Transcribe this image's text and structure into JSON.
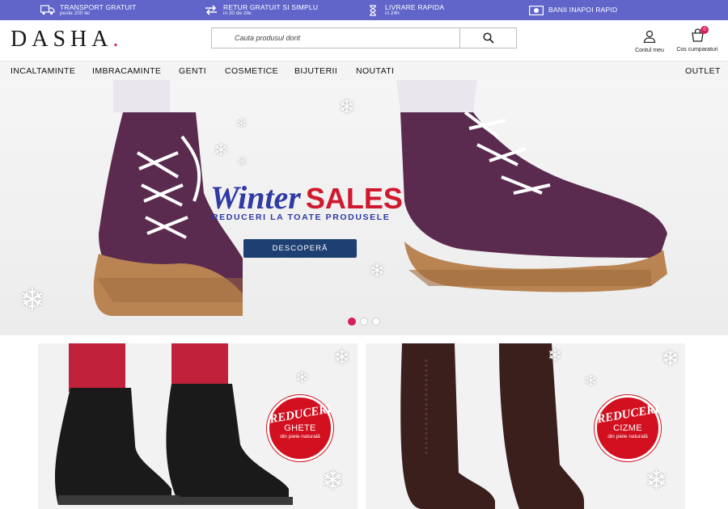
{
  "topbar": {
    "items": [
      {
        "icon": "truck-icon",
        "title": "TRANSPORT GRATUIT",
        "sub": "peste 200 lei"
      },
      {
        "icon": "exchange-icon",
        "title": "RETUR GRATUIT SI SIMPLU",
        "sub": "in 30 de zile"
      },
      {
        "icon": "hourglass-icon",
        "title": "LIVRARE RAPIDA",
        "sub": "in 24h"
      },
      {
        "icon": "money-icon",
        "title": "BANII INAPOI RAPID",
        "sub": ""
      }
    ]
  },
  "header": {
    "logo": "DASHA",
    "logo_dot": ".",
    "search_placeholder": "Cauta produsul dorit",
    "account_label": "Contul meu",
    "cart_label": "Cos cumparaturi",
    "cart_count": "0"
  },
  "nav": {
    "items": [
      "INCALTAMINTE",
      "IMBRACAMINTE",
      "GENTI",
      "COSMETICE",
      "BIJUTERII",
      "NOUTATI"
    ],
    "right": "OUTLET"
  },
  "hero": {
    "title_script": "Winter",
    "title_bold": "SALES",
    "subtitle": "REDUCERI LA TOATE PRODUSELE",
    "button": "DESCOPERĂ",
    "slides": 3,
    "active_slide": 1
  },
  "promos": [
    {
      "badge": "REDUCERI",
      "product": "GHETE",
      "note": "din piele naturală"
    },
    {
      "badge": "REDUCERI",
      "product": "CIZME",
      "note": "din piele naturală"
    }
  ],
  "colors": {
    "topbar": "#6165c9",
    "brand_pink": "#d81f5a",
    "hero_blue": "#2f3aa3",
    "hero_red": "#d0192e",
    "button": "#1e3f72",
    "seal_red": "#d3101f"
  }
}
